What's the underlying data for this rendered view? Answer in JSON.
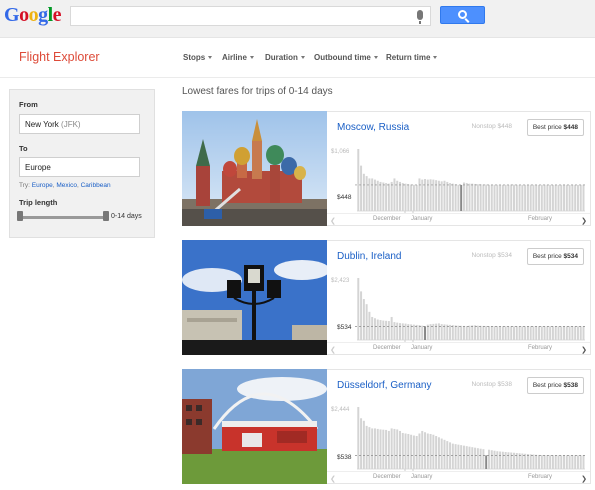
{
  "google_bar": {
    "logo": [
      "G",
      "o",
      "o",
      "g",
      "l",
      "e"
    ],
    "logo_colors": [
      "#3369e8",
      "#d50f25",
      "#eeb211",
      "#3369e8",
      "#009925",
      "#d50f25"
    ],
    "search_value": ""
  },
  "header": {
    "title": "Flight Explorer",
    "filters": [
      "Stops",
      "Airline",
      "Duration",
      "Outbound time",
      "Return time"
    ]
  },
  "search_panel": {
    "from_label": "From",
    "from_city": "New York",
    "from_code": "(JFK)",
    "to_label": "To",
    "to_value": "Europe",
    "try_label": "Try:",
    "try_links": [
      "Europe",
      "Mexico",
      "Caribbean"
    ],
    "trip_length_label": "Trip length",
    "trip_length_value": "0-14 days"
  },
  "results": {
    "title": "Lowest fares for trips of 0-14 days",
    "months": [
      "December",
      "January",
      "February"
    ],
    "cards": [
      {
        "city": "Moscow, Russia",
        "nonstop": "Nonstop $448",
        "best_label": "Best price",
        "best_price": "$448",
        "max_label": "$1,066",
        "min_label": "$448",
        "max": 1066,
        "min": 448,
        "highlight_index": 37,
        "bars": [
          1066,
          780,
          640,
          600,
          560,
          560,
          540,
          520,
          500,
          490,
          480,
          470,
          500,
          560,
          520,
          500,
          480,
          470,
          460,
          455,
          450,
          448,
          560,
          540,
          550,
          540,
          545,
          540,
          530,
          520,
          510,
          520,
          500,
          480,
          470,
          460,
          450,
          448,
          490,
          480,
          470,
          470,
          465,
          460,
          460,
          455,
          455,
          450,
          452,
          450,
          451,
          449,
          449,
          450,
          448,
          455,
          452,
          451,
          450,
          449,
          450,
          449,
          451,
          450,
          449,
          448,
          450,
          452,
          450,
          449,
          448,
          449,
          448,
          450,
          455,
          449,
          448,
          450,
          449,
          448,
          450,
          452
        ]
      },
      {
        "city": "Dublin, Ireland",
        "nonstop": "Nonstop $534",
        "best_label": "Best price",
        "best_price": "$534",
        "max_label": "$2,423",
        "min_label": "$534",
        "max": 2423,
        "min": 534,
        "highlight_index": 24,
        "bars": [
          2423,
          1900,
          1600,
          1400,
          1100,
          900,
          850,
          800,
          780,
          760,
          750,
          740,
          900,
          700,
          680,
          660,
          650,
          640,
          620,
          610,
          600,
          590,
          580,
          560,
          534,
          600,
          620,
          630,
          640,
          650,
          620,
          610,
          600,
          590,
          580,
          570,
          560,
          555,
          550,
          545,
          560,
          570,
          575,
          560,
          555,
          550,
          548,
          545,
          543,
          540,
          540,
          538,
          537,
          536,
          536,
          535,
          535,
          540,
          538,
          536,
          535,
          534,
          536,
          535,
          534,
          540,
          536,
          535,
          534,
          536,
          535,
          534,
          536,
          535,
          534,
          536,
          537,
          535,
          534,
          536,
          535,
          534
        ]
      },
      {
        "city": "Düsseldorf, Germany",
        "nonstop": "Nonstop $538",
        "best_label": "Best price",
        "best_price": "$538",
        "max_label": "$2,444",
        "min_label": "$538",
        "max": 2444,
        "min": 538,
        "highlight_index": 46,
        "bars": [
          2444,
          2000,
          1900,
          1700,
          1650,
          1600,
          1600,
          1580,
          1560,
          1550,
          1540,
          1500,
          1600,
          1580,
          1560,
          1500,
          1420,
          1400,
          1380,
          1350,
          1320,
          1300,
          1400,
          1500,
          1450,
          1400,
          1380,
          1350,
          1300,
          1250,
          1200,
          1150,
          1100,
          1050,
          1000,
          980,
          960,
          940,
          920,
          900,
          880,
          860,
          840,
          820,
          800,
          780,
          538,
          760,
          740,
          720,
          700,
          690,
          680,
          670,
          660,
          650,
          640,
          630,
          620,
          610,
          600,
          590,
          580,
          570,
          560,
          555,
          550,
          548,
          546,
          544,
          542,
          541,
          540,
          540,
          539,
          539,
          538,
          539,
          538,
          539,
          538,
          540
        ]
      }
    ]
  }
}
